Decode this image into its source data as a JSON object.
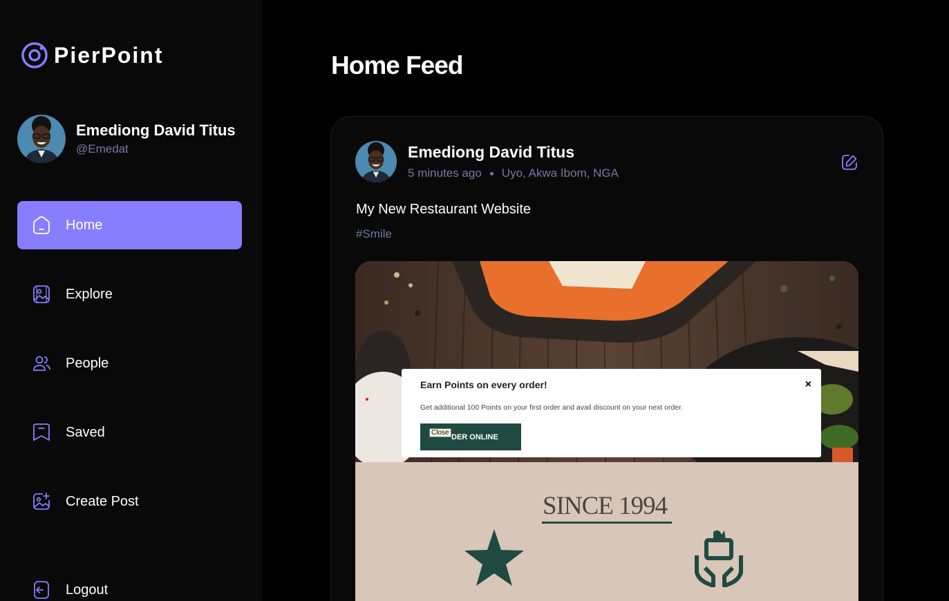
{
  "app": {
    "name": "PierPoint",
    "accent": "#877eff",
    "muted": "#7878a3"
  },
  "user": {
    "name": "Emediong David Titus",
    "handle": "@Emedat"
  },
  "nav": {
    "home": "Home",
    "explore": "Explore",
    "people": "People",
    "saved": "Saved",
    "create": "Create Post",
    "logout": "Logout"
  },
  "page": {
    "title": "Home Feed"
  },
  "post": {
    "author": "Emediong David Titus",
    "time": "5 minutes ago",
    "location": "Uyo, Akwa Ibom, NGA",
    "caption": "My New Restaurant Website",
    "tag": "#Smile",
    "image": {
      "popup_title": "Earn Points on every order!",
      "popup_close": "×",
      "popup_text": "Get additional 100 Points on your first order and avail discount on your next order.",
      "popup_button": "DER ONLINE",
      "tooltip": "Close",
      "since": "SINCE 1994"
    }
  }
}
